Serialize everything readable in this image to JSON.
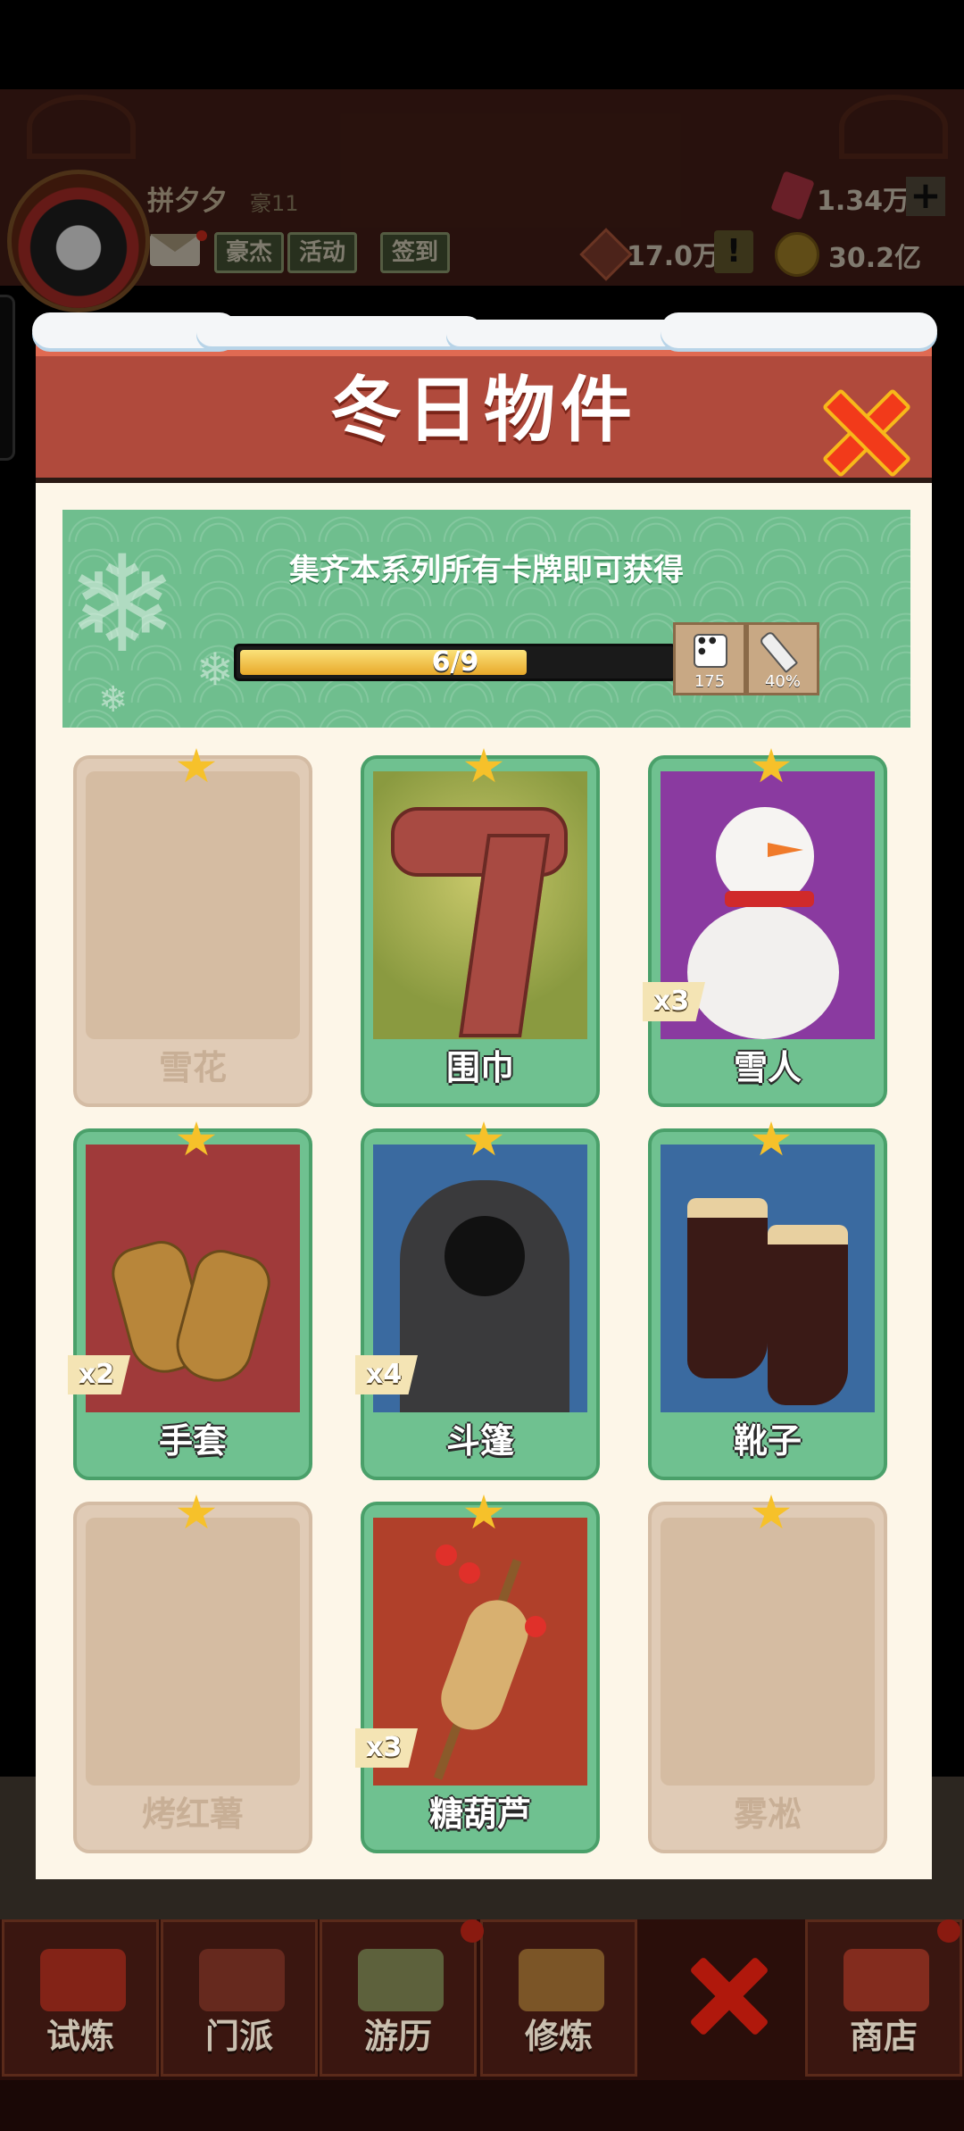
{
  "header": {
    "player_name": "拼夕夕",
    "player_rank": "豪11",
    "buttons": [
      "豪杰",
      "活动",
      "签到"
    ],
    "gems": "1.34万",
    "tickets": "17.0万",
    "coins": "30.2亿",
    "plus_label": "+",
    "alert_label": "!"
  },
  "modal": {
    "title": "冬日物件",
    "banner_text": "集齐本系列所有卡牌即可获得",
    "progress_text": "6/9",
    "progress_fraction": 0.667,
    "rewards": [
      {
        "icon": "dice-icon",
        "value": "175"
      },
      {
        "icon": "sword-icon",
        "value": "40%"
      }
    ]
  },
  "cards": [
    {
      "name": "雪花",
      "owned": false,
      "count": ""
    },
    {
      "name": "围巾",
      "owned": true,
      "count": ""
    },
    {
      "name": "雪人",
      "owned": true,
      "count": "x3"
    },
    {
      "name": "手套",
      "owned": true,
      "count": "x2"
    },
    {
      "name": "斗篷",
      "owned": true,
      "count": "x4"
    },
    {
      "name": "靴子",
      "owned": true,
      "count": ""
    },
    {
      "name": "烤红薯",
      "owned": false,
      "count": ""
    },
    {
      "name": "糖葫芦",
      "owned": true,
      "count": "x3"
    },
    {
      "name": "雾凇",
      "owned": false,
      "count": ""
    }
  ],
  "bottom_nav": [
    {
      "label": "试炼"
    },
    {
      "label": "门派"
    },
    {
      "label": "游历"
    },
    {
      "label": "修炼"
    },
    {
      "label": "商店"
    }
  ],
  "colors": {
    "header_red": "#b04a3c",
    "banner_green": "#6fbe8e",
    "card_green": "#6fc190",
    "locked_card": "#e0cbb6",
    "star_gold": "#f6c12a",
    "close_red": "#f23a1a"
  }
}
